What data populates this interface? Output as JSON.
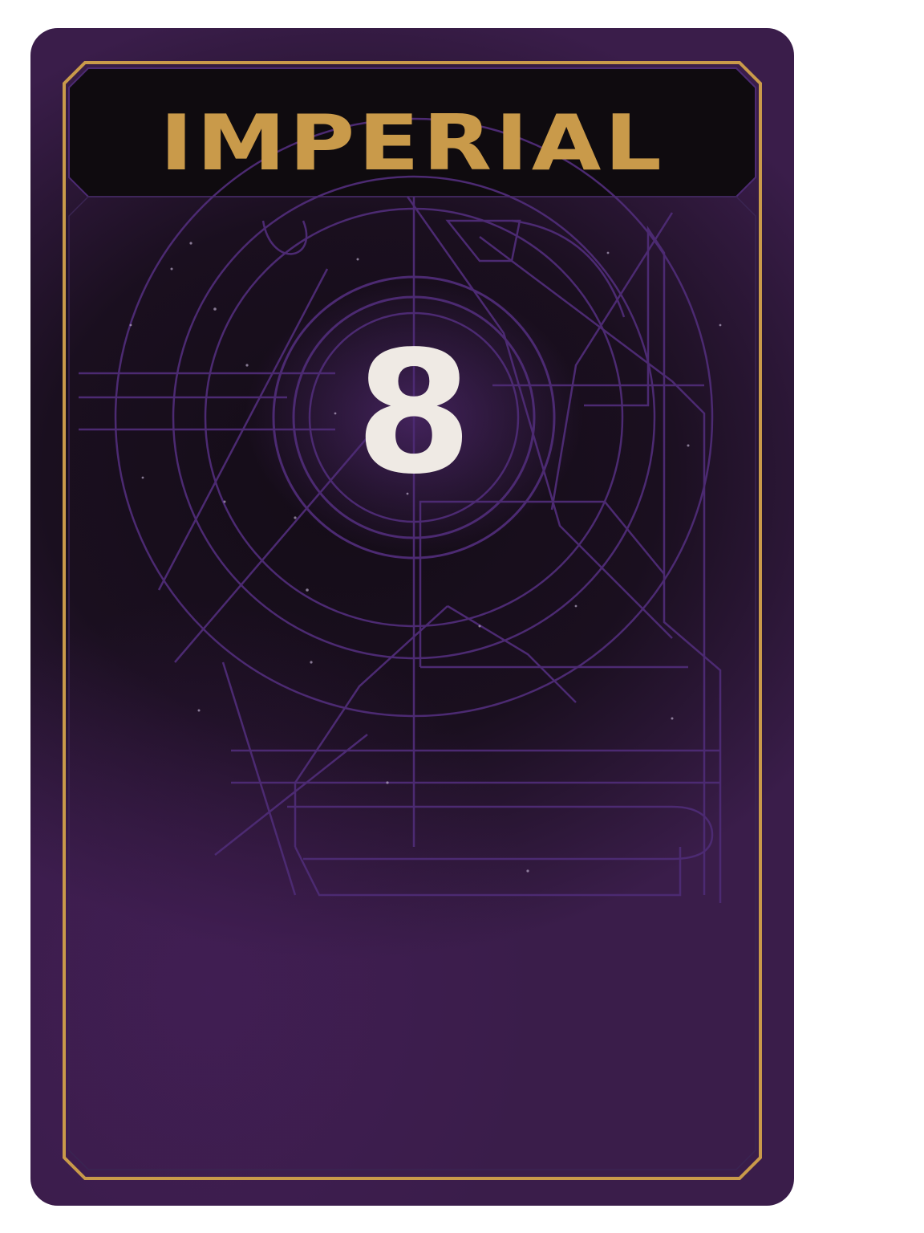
{
  "card": {
    "title": "IMPERIAL",
    "value": "8"
  },
  "colors": {
    "gold": "#c99a4a",
    "purple_line": "#4c2a72",
    "number": "#efeae4",
    "card_base": "#1a0f1f"
  }
}
